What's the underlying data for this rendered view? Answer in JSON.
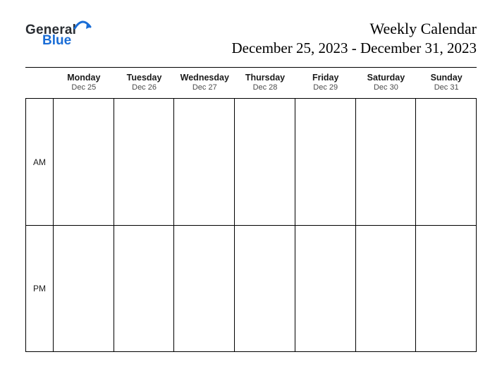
{
  "logo": {
    "word1": "General",
    "word2": "Blue",
    "arc_color": "#1a6dd6"
  },
  "title": {
    "main": "Weekly Calendar",
    "range": "December 25, 2023 - December 31, 2023"
  },
  "days": [
    {
      "name": "Monday",
      "date": "Dec 25"
    },
    {
      "name": "Tuesday",
      "date": "Dec 26"
    },
    {
      "name": "Wednesday",
      "date": "Dec 27"
    },
    {
      "name": "Thursday",
      "date": "Dec 28"
    },
    {
      "name": "Friday",
      "date": "Dec 29"
    },
    {
      "name": "Saturday",
      "date": "Dec 30"
    },
    {
      "name": "Sunday",
      "date": "Dec 31"
    }
  ],
  "row_labels": {
    "am": "AM",
    "pm": "PM"
  }
}
